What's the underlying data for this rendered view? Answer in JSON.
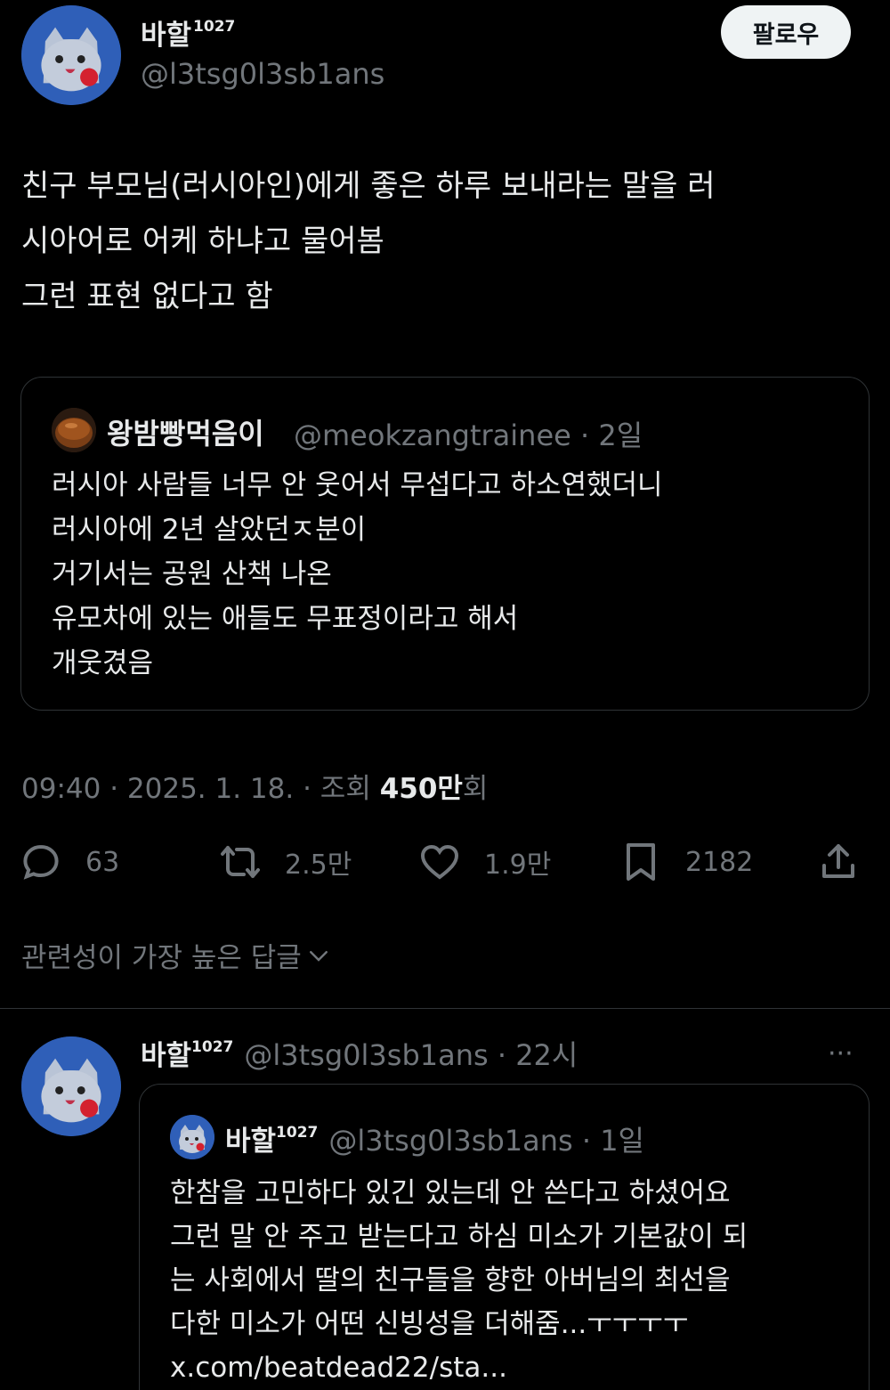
{
  "author": {
    "display_name": "바할",
    "name_suffix": "1027",
    "handle": "@l3tsg0l3sb1ans"
  },
  "follow_label": "팔로우",
  "tweet": {
    "lines": [
      "친구 부모님(러시아인)에게 좋은 하루 보내라는 말을 러",
      "시아어로 어케 하냐고 물어봄",
      "그런 표현 없다고 함"
    ]
  },
  "quote": {
    "name": "왕밤빵먹음이",
    "meta": "@meokzangtrainee · 2일",
    "lines": [
      "러시아 사람들 너무 안 웃어서 무섭다고 하소연했더니",
      "러시아에 2년 살았던ㅈ분이",
      "거기서는 공원 산책 나온",
      "유모차에 있는 애들도 무표정이라고 해서",
      "개웃겼음"
    ]
  },
  "timestamp": {
    "prefix": "09:40 · 2025. 1. 18. · 조회 ",
    "views": "450만",
    "suffix": "회"
  },
  "actions": {
    "replies": "63",
    "retweets": "2.5만",
    "likes": "1.9만",
    "bookmarks": "2182"
  },
  "sort_label": "관련성이 가장 높은 답글",
  "reply": {
    "display_name": "바할",
    "name_suffix": "1027",
    "meta": "@l3tsg0l3sb1ans · 22시",
    "more": "···",
    "quote": {
      "display_name": "바할",
      "name_suffix": "1027",
      "meta": "@l3tsg0l3sb1ans · 1일",
      "lines": [
        "한참을 고민하다 있긴 있는데 안 쓴다고 하셨어요",
        "그런 말 안 주고 받는다고 하심 미소가 기본값이 되",
        "는 사회에서 딸의 친구들을 향한 아버님의 최선을",
        "다한 미소가 어떤 신빙성을 더해줌...ㅜㅜㅜㅜ",
        "x.com/beatdead22/sta..."
      ]
    }
  },
  "colors": {
    "background": "#000000",
    "text": "#e7e9ea",
    "muted": "#71767b",
    "border": "#2f3336",
    "avatar_bg": "#2f5fb8"
  }
}
